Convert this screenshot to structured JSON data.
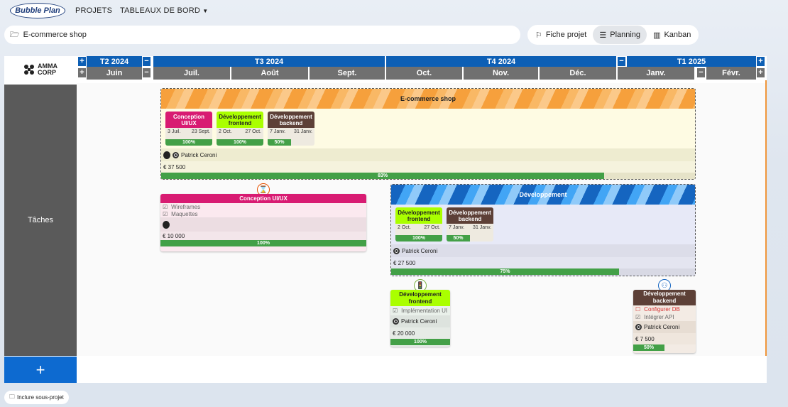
{
  "app": {
    "logo": "Bubble Plan",
    "nav_projects": "PROJETS",
    "nav_dashboards": "TABLEAUX DE BORD"
  },
  "project": {
    "name": "E-commerce shop"
  },
  "view_tabs": [
    {
      "label": "Fiche projet"
    },
    {
      "label": "Planning"
    },
    {
      "label": "Kanban"
    }
  ],
  "company": {
    "line1": "AMMA",
    "line2": "CORP"
  },
  "quarters": [
    {
      "label": "T2 2024"
    },
    {
      "label": "T3 2024"
    },
    {
      "label": "T4 2024"
    },
    {
      "label": "T1 2025"
    }
  ],
  "months": [
    "Juin",
    "Juil.",
    "Août",
    "Sept.",
    "Oct.",
    "Nov.",
    "Déc.",
    "Janv.",
    "Févr."
  ],
  "row_label": "Tâches",
  "main_project": {
    "title": "E-commerce shop",
    "subtasks": [
      {
        "title": "Conception UI/UX",
        "start": "3 Juil.",
        "end": "23 Sept.",
        "progress": "100%",
        "color": "#d81b72",
        "text": "#fff"
      },
      {
        "title": "Développement frontend",
        "start": "2 Oct.",
        "end": "27 Oct.",
        "progress": "100%",
        "color": "#aaff00",
        "text": "#222"
      },
      {
        "title": "Développement backend",
        "start": "7 Janv.",
        "end": "31 Janv.",
        "progress": "50%",
        "color": "#5d4037",
        "text": "#fff"
      }
    ],
    "owner": "Patrick Ceroni",
    "budget": "€ 37 500",
    "progress": "83%",
    "progress_value": 83
  },
  "conception": {
    "title": "Conception UI/UX",
    "items": [
      "Wireframes",
      "Maquettes"
    ],
    "budget": "€ 10 000",
    "progress": "100%",
    "color": "#d81b72"
  },
  "dev_project": {
    "title": "Développement",
    "subtasks": [
      {
        "title": "Développement frontend",
        "start": "2 Oct.",
        "end": "27 Oct.",
        "progress": "100%",
        "color": "#aaff00",
        "text": "#222"
      },
      {
        "title": "Développement backend",
        "start": "7 Janv.",
        "end": "31 Janv.",
        "progress": "50%",
        "color": "#5d4037",
        "text": "#fff"
      }
    ],
    "owner": "Patrick Ceroni",
    "budget": "€ 27 500",
    "progress": "75%",
    "progress_value": 75
  },
  "frontend": {
    "title": "Développement frontend",
    "items": [
      "Implémentation UI"
    ],
    "owner": "Patrick Ceroni",
    "budget": "€ 20 000",
    "progress": "100%"
  },
  "backend": {
    "title": "Développement backend",
    "items": [
      "Configurer DB",
      "Intégrer API"
    ],
    "owner": "Patrick Ceroni",
    "budget": "€ 7 500",
    "progress": "50%"
  },
  "include_subproject": "Inclure sous-projet"
}
